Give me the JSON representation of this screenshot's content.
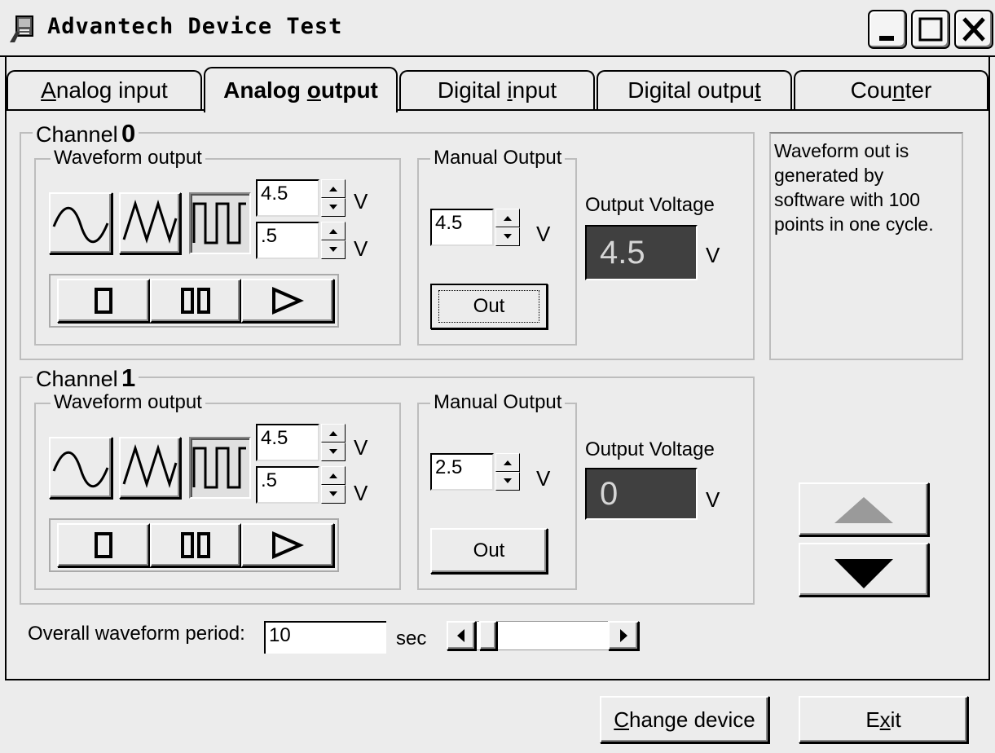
{
  "window": {
    "title": "Advantech Device Test"
  },
  "tabs": [
    {
      "label": "Analog input",
      "hot": "A",
      "rest": "nalog input"
    },
    {
      "label": "Analog output",
      "pre": "Analog ",
      "hot": "o",
      "rest": "utput"
    },
    {
      "label": "Digital input",
      "pre": "Digital ",
      "hot": "i",
      "rest": "nput"
    },
    {
      "label": "Digital output",
      "pre": "Digital outpu",
      "hot": "t",
      "rest": ""
    },
    {
      "label": "Counter",
      "pre": "Cou",
      "hot": "n",
      "rest": "ter"
    }
  ],
  "channels": [
    {
      "label": "Channel",
      "number": "0",
      "waveform_label": "Waveform output",
      "high_value": "4.5",
      "low_value": ".5",
      "unit": "V",
      "manual_label": "Manual Output",
      "manual_value": "4.5",
      "out_label": "Out",
      "output_voltage_label": "Output Voltage",
      "output_voltage": "4.5"
    },
    {
      "label": "Channel",
      "number": "1",
      "waveform_label": "Waveform output",
      "high_value": "4.5",
      "low_value": ".5",
      "unit": "V",
      "manual_label": "Manual Output",
      "manual_value": "2.5",
      "out_label": "Out",
      "output_voltage_label": "Output Voltage",
      "output_voltage": "0"
    }
  ],
  "info_text": "Waveform out is generated by software with 100 points  in one cycle.",
  "period": {
    "label": "Overall waveform period:",
    "value": "10",
    "unit": "sec"
  },
  "buttons": {
    "change_device": {
      "hot": "C",
      "rest": "hange device"
    },
    "exit": {
      "pre": "E",
      "hot": "x",
      "rest": "it"
    }
  },
  "icons": [
    "app-icon",
    "minimize-icon",
    "maximize-icon",
    "close-icon",
    "sine-wave-icon",
    "triangle-wave-icon",
    "square-wave-icon",
    "stop-icon",
    "pause-icon",
    "play-icon",
    "arrow-up-icon",
    "arrow-down-icon"
  ]
}
